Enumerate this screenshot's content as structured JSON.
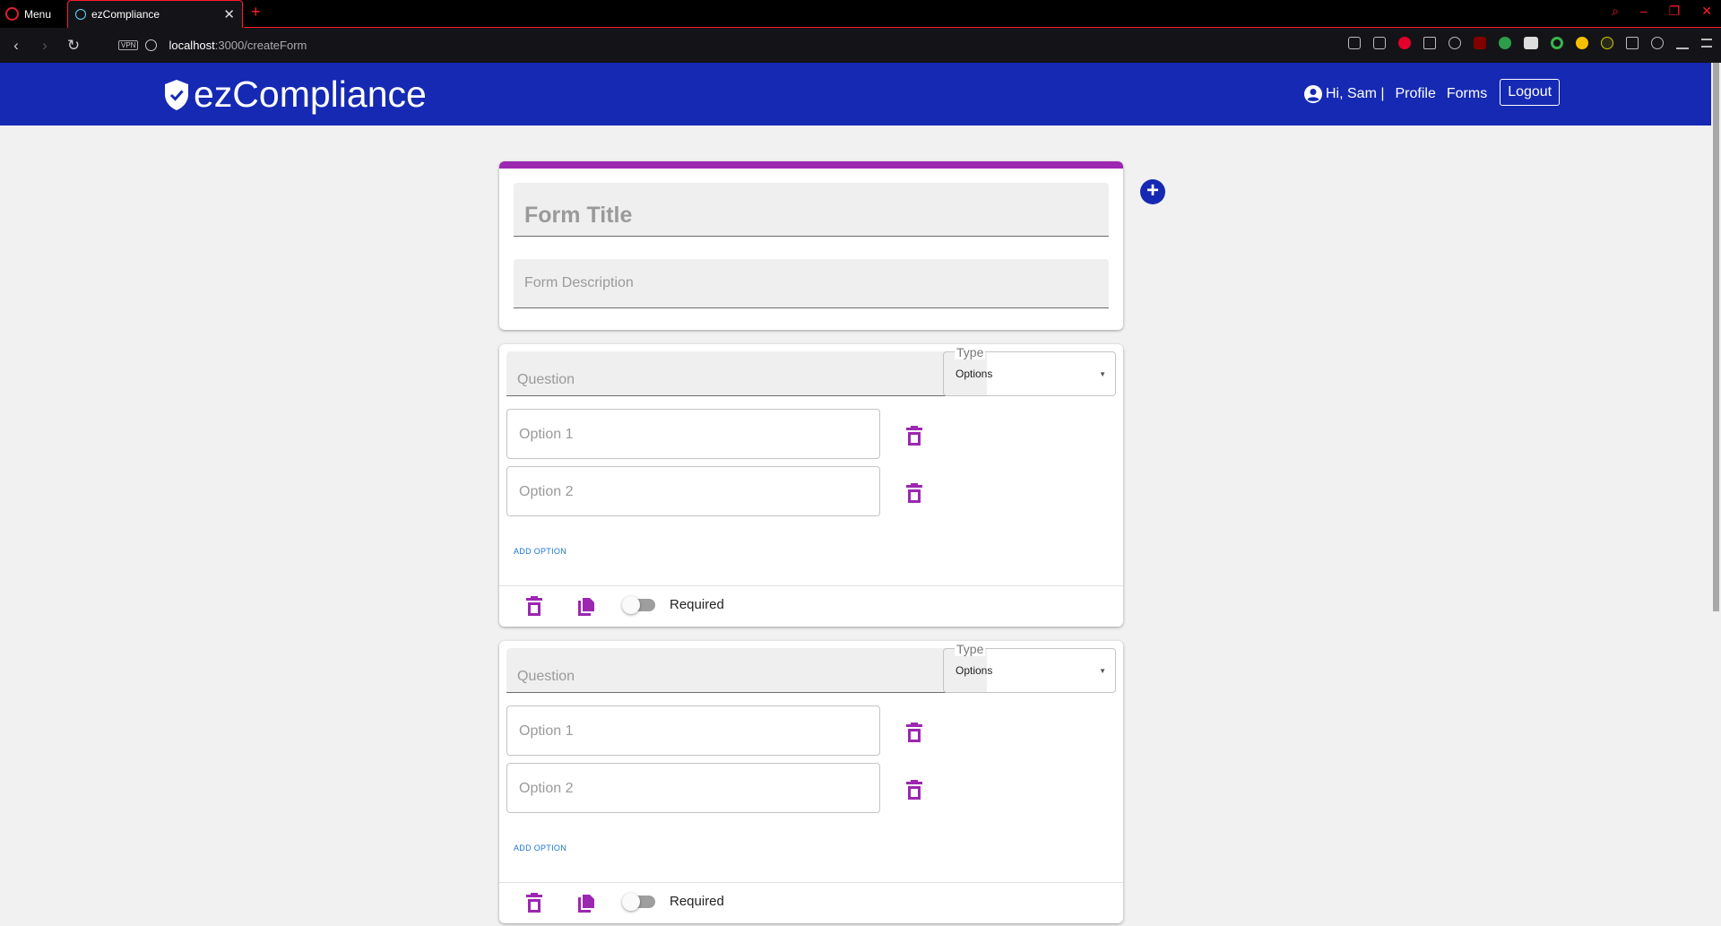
{
  "browser": {
    "menu_label": "Menu",
    "tab_title": "ezCompliance",
    "url_host": "localhost",
    "url_path": ":3000/createForm",
    "vpn_label": "VPN"
  },
  "navbar": {
    "brand": "ezCompliance",
    "greeting": "Hi, Sam |",
    "profile": "Profile",
    "forms": "Forms",
    "logout": "Logout",
    "color": "#1529b3"
  },
  "form": {
    "title_placeholder": "Form Title",
    "description_placeholder": "Form Description",
    "accent_color": "#9c27b0"
  },
  "questions": [
    {
      "question_placeholder": "Question",
      "type_label": "Type",
      "type_value": "Options",
      "options": [
        "Option 1",
        "Option 2"
      ],
      "add_option": "ADD OPTION",
      "required_label": "Required",
      "required": false
    },
    {
      "question_placeholder": "Question",
      "type_label": "Type",
      "type_value": "Options",
      "options": [
        "Option 1",
        "Option 2"
      ],
      "add_option": "ADD OPTION",
      "required_label": "Required",
      "required": false
    }
  ]
}
